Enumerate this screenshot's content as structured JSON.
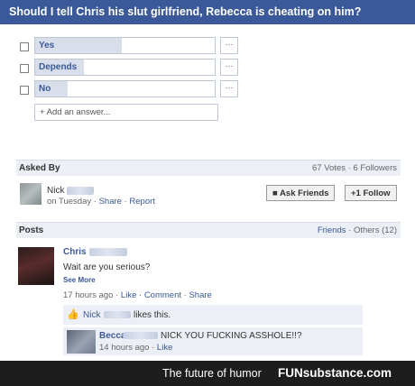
{
  "question": {
    "text": "Should I tell Chris his slut girlfriend, Rebecca is cheating on him?"
  },
  "options": [
    {
      "label": "Yes",
      "more": "···",
      "fill": 0.48
    },
    {
      "label": "Depends",
      "more": "···",
      "fill": 0.27
    },
    {
      "label": "No",
      "more": "···",
      "fill": 0.18
    }
  ],
  "add_answer": "+ Add an answer...",
  "asked_by": {
    "header": "Asked By",
    "stats": "67 Votes · 6 Followers",
    "name": "Nick",
    "meta_day": "on Tuesday",
    "share": "Share",
    "report": "Report",
    "ask_friends": "Ask Friends",
    "follow": "Follow"
  },
  "posts": {
    "header": "Posts",
    "filter_friends": "Friends",
    "filter_others": "Others (12)",
    "post": {
      "author": "Chris",
      "text": "Wait are you serious?",
      "see_more": "See More",
      "time": "17 hours ago",
      "like": "Like",
      "comment": "Comment",
      "share": "Share"
    },
    "likes": {
      "name": "Nick",
      "text": "likes this."
    },
    "reply": {
      "author": "Becca",
      "text": "NICK YOU FUCKING ASSHOLE!!?",
      "time": "14 hours ago",
      "like": "Like"
    }
  },
  "footer": {
    "tagline": "The future of humor",
    "brand": "FUNsubstance.com"
  }
}
